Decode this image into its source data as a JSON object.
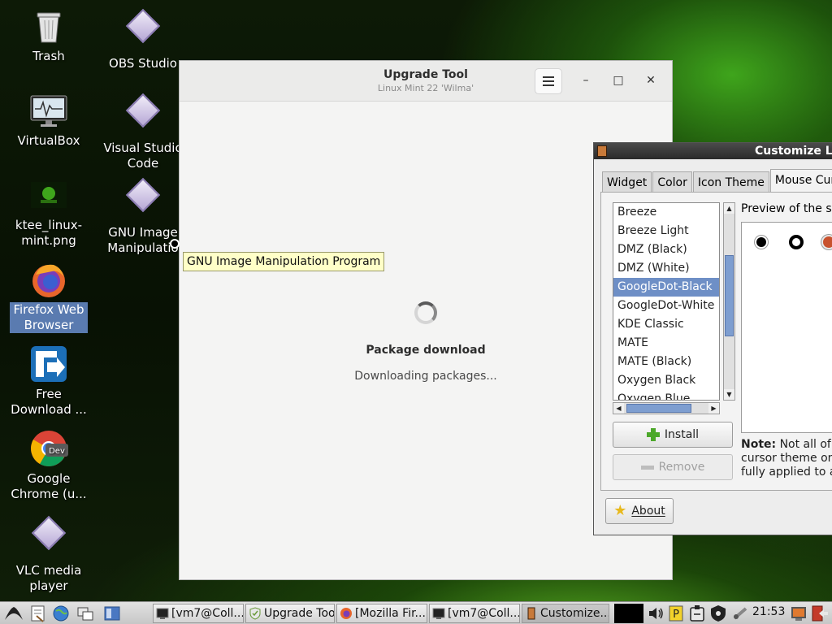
{
  "desktop": {
    "icons": [
      {
        "label": "Trash"
      },
      {
        "label": "OBS Studio"
      },
      {
        "label": "VirtualBox"
      },
      {
        "label": "Visual Studio Code"
      },
      {
        "label": "ktee_linux-mint.png"
      },
      {
        "label": "GNU Image Manipulatio"
      },
      {
        "label": "Firefox Web Browser"
      },
      {
        "label": "Free Download ..."
      },
      {
        "label": "Google Chrome (u..."
      },
      {
        "label": "VLC media player"
      }
    ],
    "tooltip": "GNU Image Manipulation Program"
  },
  "upgrade_tool": {
    "title": "Upgrade Tool",
    "subtitle": "Linux Mint 22 'Wilma'",
    "status_title": "Package download",
    "status_text": "Downloading packages...",
    "minimize": "–",
    "maximize": "□",
    "close": "✕"
  },
  "customize": {
    "title": "Customize Lo",
    "tabs": [
      "Widget",
      "Color",
      "Icon Theme",
      "Mouse Cursor"
    ],
    "active_tab": "Mouse Cursor",
    "themes": [
      "Breeze",
      "Breeze Light",
      "DMZ (Black)",
      "DMZ (White)",
      "GoogleDot-Black",
      "GoogleDot-White",
      "KDE Classic",
      "MATE",
      "MATE (Black)",
      "Oxygen Black",
      "Oxygen Blue"
    ],
    "selected_theme": "GoogleDot-Black",
    "preview_label": "Preview of the se",
    "install_label": "Install",
    "remove_label": "Remove",
    "note_bold": "Note:",
    "note_text": " Not all of t cursor theme on-t fully applied to al",
    "about_label": "About"
  },
  "taskbar": {
    "tasks": [
      {
        "label": "[vm7@Coll...",
        "icon": "terminal-icon"
      },
      {
        "label": "Upgrade Tool",
        "icon": "mint-shield-icon"
      },
      {
        "label": "[Mozilla Fir...",
        "icon": "firefox-icon"
      },
      {
        "label": "[vm7@Coll...",
        "icon": "terminal-icon"
      },
      {
        "label": "Customize...",
        "icon": "customize-icon"
      }
    ],
    "clock": "21:53"
  },
  "colors": {
    "selection": "#6e8fc6",
    "desktop_selected": "#5a7bb0",
    "tooltip_bg": "#ffffc8"
  }
}
